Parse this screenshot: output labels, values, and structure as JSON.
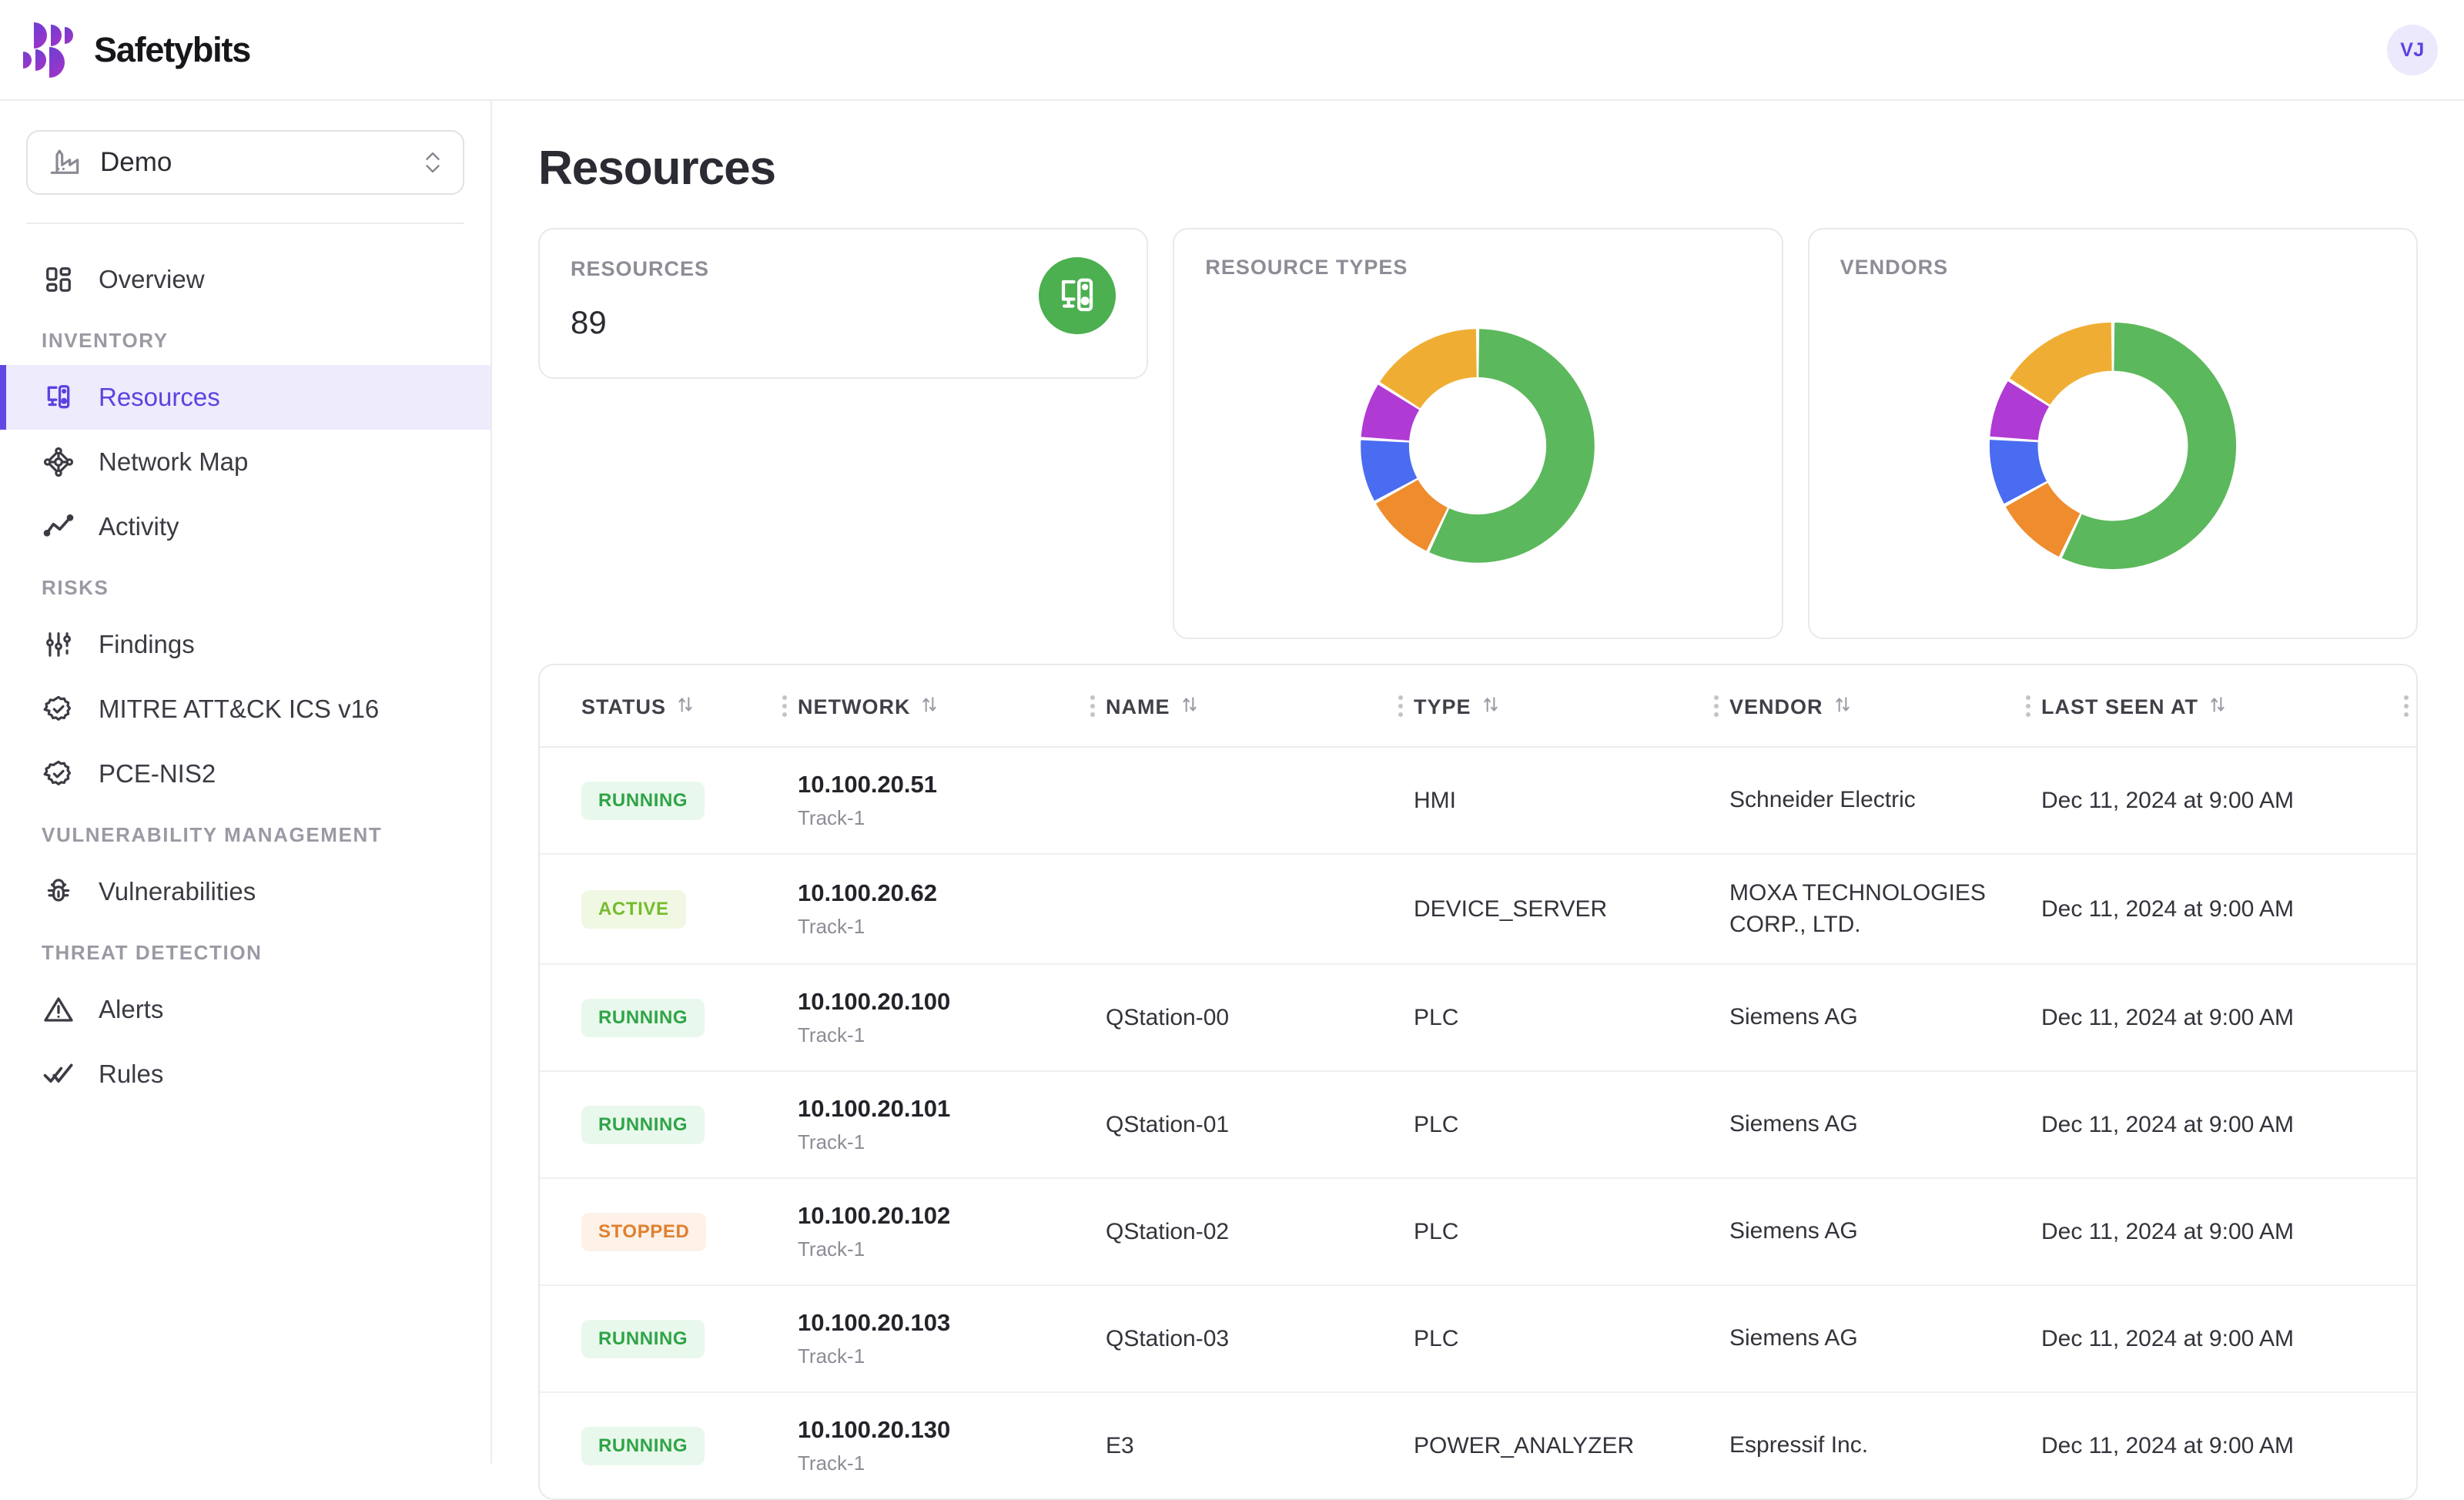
{
  "brand": {
    "name": "Safetybits",
    "logo_icon": "safetybits-logo-icon",
    "accent": "#6049e3"
  },
  "topbar": {
    "avatar_initials": "VJ"
  },
  "sidebar": {
    "org": {
      "label": "Demo",
      "icon": "factory-icon",
      "chevron_icon": "chevron-up-down-icon"
    },
    "items": [
      {
        "label": "Overview",
        "icon": "dashboard-grid-icon",
        "active": false,
        "section": null
      },
      {
        "label": "INVENTORY",
        "type": "section"
      },
      {
        "label": "Resources",
        "icon": "devices-icon",
        "active": true
      },
      {
        "label": "Network Map",
        "icon": "network-nodes-icon",
        "active": false
      },
      {
        "label": "Activity",
        "icon": "activity-line-icon",
        "active": false
      },
      {
        "label": "RISKS",
        "type": "section"
      },
      {
        "label": "Findings",
        "icon": "sliders-icon",
        "active": false
      },
      {
        "label": "MITRE ATT&CK ICS v16",
        "icon": "badge-check-icon",
        "active": false
      },
      {
        "label": "PCE-NIS2",
        "icon": "badge-check-icon",
        "active": false
      },
      {
        "label": "VULNERABILITY MANAGEMENT",
        "type": "section"
      },
      {
        "label": "Vulnerabilities",
        "icon": "bug-icon",
        "active": false
      },
      {
        "label": "THREAT DETECTION",
        "type": "section"
      },
      {
        "label": "Alerts",
        "icon": "warning-triangle-icon",
        "active": false
      },
      {
        "label": "Rules",
        "icon": "double-check-icon",
        "active": false
      }
    ]
  },
  "main": {
    "page_title": "Resources",
    "stat_card": {
      "label": "RESOURCES",
      "value": "89",
      "icon": "devices-icon",
      "badge_color": "#4caf50"
    },
    "resource_types_card": {
      "title": "RESOURCE TYPES"
    },
    "vendors_card": {
      "title": "VENDORS"
    }
  },
  "chart_data": [
    {
      "type": "pie",
      "title": "RESOURCE TYPES",
      "legend": "none",
      "donut": true,
      "categories": [
        "Green",
        "Orange",
        "Blue",
        "Purple",
        "Amber"
      ],
      "values": [
        57,
        10,
        9,
        8,
        16
      ],
      "colors": [
        "#5cb85c",
        "#ef8c2d",
        "#4a6cf0",
        "#b03ad4",
        "#efae33"
      ],
      "start_angle_deg": 0
    },
    {
      "type": "pie",
      "title": "VENDORS",
      "legend": "none",
      "donut": true,
      "categories": [
        "Green",
        "Orange",
        "Blue",
        "Purple",
        "Amber"
      ],
      "values": [
        57,
        10,
        9,
        8,
        16
      ],
      "colors": [
        "#5cb85c",
        "#ef8c2d",
        "#4a6cf0",
        "#b03ad4",
        "#efae33"
      ],
      "start_angle_deg": 0
    }
  ],
  "table": {
    "columns": [
      {
        "label": "STATUS",
        "sort_icon": "sort-updown-icon",
        "menu_icon": "column-menu-icon"
      },
      {
        "label": "NETWORK",
        "sort_icon": "sort-updown-icon",
        "menu_icon": "column-menu-icon"
      },
      {
        "label": "NAME",
        "sort_icon": "sort-updown-icon",
        "menu_icon": "column-menu-icon"
      },
      {
        "label": "TYPE",
        "sort_icon": "sort-updown-icon",
        "menu_icon": "column-menu-icon"
      },
      {
        "label": "VENDOR",
        "sort_icon": "sort-updown-icon",
        "menu_icon": "column-menu-icon"
      },
      {
        "label": "LAST SEEN AT",
        "sort_icon": "sort-updown-icon",
        "menu_icon": "column-menu-icon"
      }
    ],
    "rows": [
      {
        "status": "RUNNING",
        "status_kind": "running",
        "ip": "10.100.20.51",
        "track": "Track-1",
        "name": "",
        "type": "HMI",
        "vendor": "Schneider Electric",
        "last_seen": "Dec 11, 2024 at 9:00 AM"
      },
      {
        "status": "ACTIVE",
        "status_kind": "active",
        "ip": "10.100.20.62",
        "track": "Track-1",
        "name": "",
        "type": "DEVICE_SERVER",
        "vendor": "MOXA TECHNOLOGIES CORP., LTD.",
        "last_seen": "Dec 11, 2024 at 9:00 AM"
      },
      {
        "status": "RUNNING",
        "status_kind": "running",
        "ip": "10.100.20.100",
        "track": "Track-1",
        "name": "QStation-00",
        "type": "PLC",
        "vendor": "Siemens AG",
        "last_seen": "Dec 11, 2024 at 9:00 AM"
      },
      {
        "status": "RUNNING",
        "status_kind": "running",
        "ip": "10.100.20.101",
        "track": "Track-1",
        "name": "QStation-01",
        "type": "PLC",
        "vendor": "Siemens AG",
        "last_seen": "Dec 11, 2024 at 9:00 AM"
      },
      {
        "status": "STOPPED",
        "status_kind": "stopped",
        "ip": "10.100.20.102",
        "track": "Track-1",
        "name": "QStation-02",
        "type": "PLC",
        "vendor": "Siemens AG",
        "last_seen": "Dec 11, 2024 at 9:00 AM"
      },
      {
        "status": "RUNNING",
        "status_kind": "running",
        "ip": "10.100.20.103",
        "track": "Track-1",
        "name": "QStation-03",
        "type": "PLC",
        "vendor": "Siemens AG",
        "last_seen": "Dec 11, 2024 at 9:00 AM"
      },
      {
        "status": "RUNNING",
        "status_kind": "running",
        "ip": "10.100.20.130",
        "track": "Track-1",
        "name": "E3",
        "type": "POWER_ANALYZER",
        "vendor": "Espressif Inc.",
        "last_seen": "Dec 11, 2024 at 9:00 AM"
      }
    ]
  }
}
